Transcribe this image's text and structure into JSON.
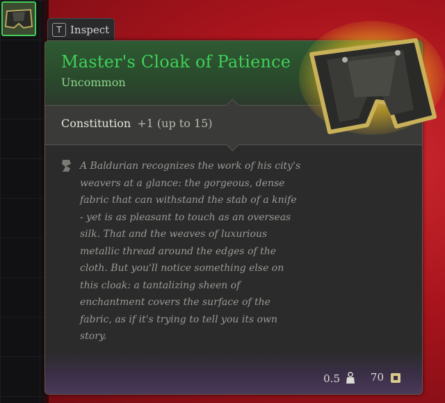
{
  "inventory": {
    "selected_slot_icon": "cloak-icon"
  },
  "inspect_tab": {
    "key": "T",
    "label": "Inspect"
  },
  "item": {
    "name": "Master's Cloak of Patience",
    "rarity": "Uncommon",
    "rarity_color": "#3fd05a",
    "stat_name": "Constitution",
    "stat_value": "+1 (up to 15)",
    "description": "A Baldurian recognizes the work of his city's weavers at a glance: the gorgeous, dense fabric that can withstand the stab of a knife - yet is as pleasant to touch as an overseas silk. That and the weaves of luxurious metallic thread around the edges of the cloth. But you'll notice something else on this cloak: a tantalizing sheen of enchantment covers the surface of the fabric, as if it's trying to tell you its own story.",
    "weight": "0.5",
    "weight_icon": "weight-icon",
    "price": "70",
    "price_icon": "gold-coin-icon"
  }
}
